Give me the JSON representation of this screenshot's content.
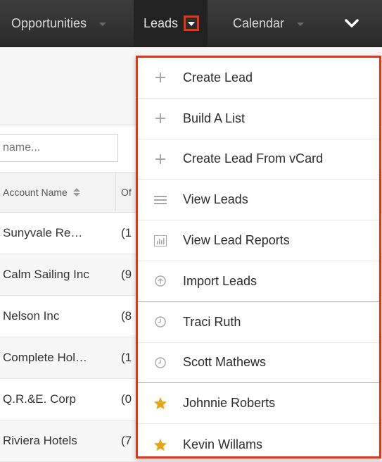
{
  "nav": {
    "items": [
      {
        "label": "Opportunities"
      },
      {
        "label": "Leads"
      },
      {
        "label": "Calendar"
      }
    ]
  },
  "list": {
    "search_placeholder": "name...",
    "columns": [
      "Account Name",
      "Of"
    ],
    "rows": [
      {
        "name": "Sunyvale Re…",
        "phone": "(1"
      },
      {
        "name": "Calm Sailing Inc",
        "phone": "(9"
      },
      {
        "name": "Nelson Inc",
        "phone": "(8"
      },
      {
        "name": "Complete Hol…",
        "phone": "(1"
      },
      {
        "name": "Q.R.&E. Corp",
        "phone": "(0"
      },
      {
        "name": "Riviera Hotels",
        "phone": "(7"
      }
    ]
  },
  "dropdown": {
    "items": [
      {
        "label": "Create Lead",
        "icon": "plus-icon"
      },
      {
        "label": "Build A List",
        "icon": "plus-icon"
      },
      {
        "label": "Create Lead From vCard",
        "icon": "plus-icon"
      },
      {
        "label": "View Leads",
        "icon": "list-icon"
      },
      {
        "label": "View Lead Reports",
        "icon": "bar-chart-icon"
      },
      {
        "label": "Import Leads",
        "icon": "upload-icon"
      },
      {
        "label": "Traci Ruth",
        "icon": "clock-icon"
      },
      {
        "label": "Scott Mathews",
        "icon": "clock-icon"
      },
      {
        "label": "Johnnie Roberts",
        "icon": "star-icon"
      },
      {
        "label": "Kevin Willams",
        "icon": "star-icon"
      }
    ]
  },
  "colors": {
    "highlight": "#e63417",
    "nav_background": "#333333",
    "favorite_star": "#e8a617"
  }
}
